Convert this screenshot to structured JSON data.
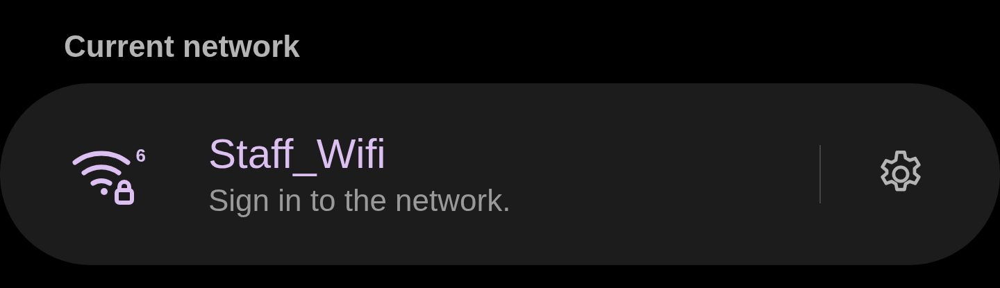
{
  "heading": "Current network",
  "network": {
    "name": "Staff_Wifi",
    "status": "Sign in to the network.",
    "wifi_standard": "6",
    "secured": true
  }
}
